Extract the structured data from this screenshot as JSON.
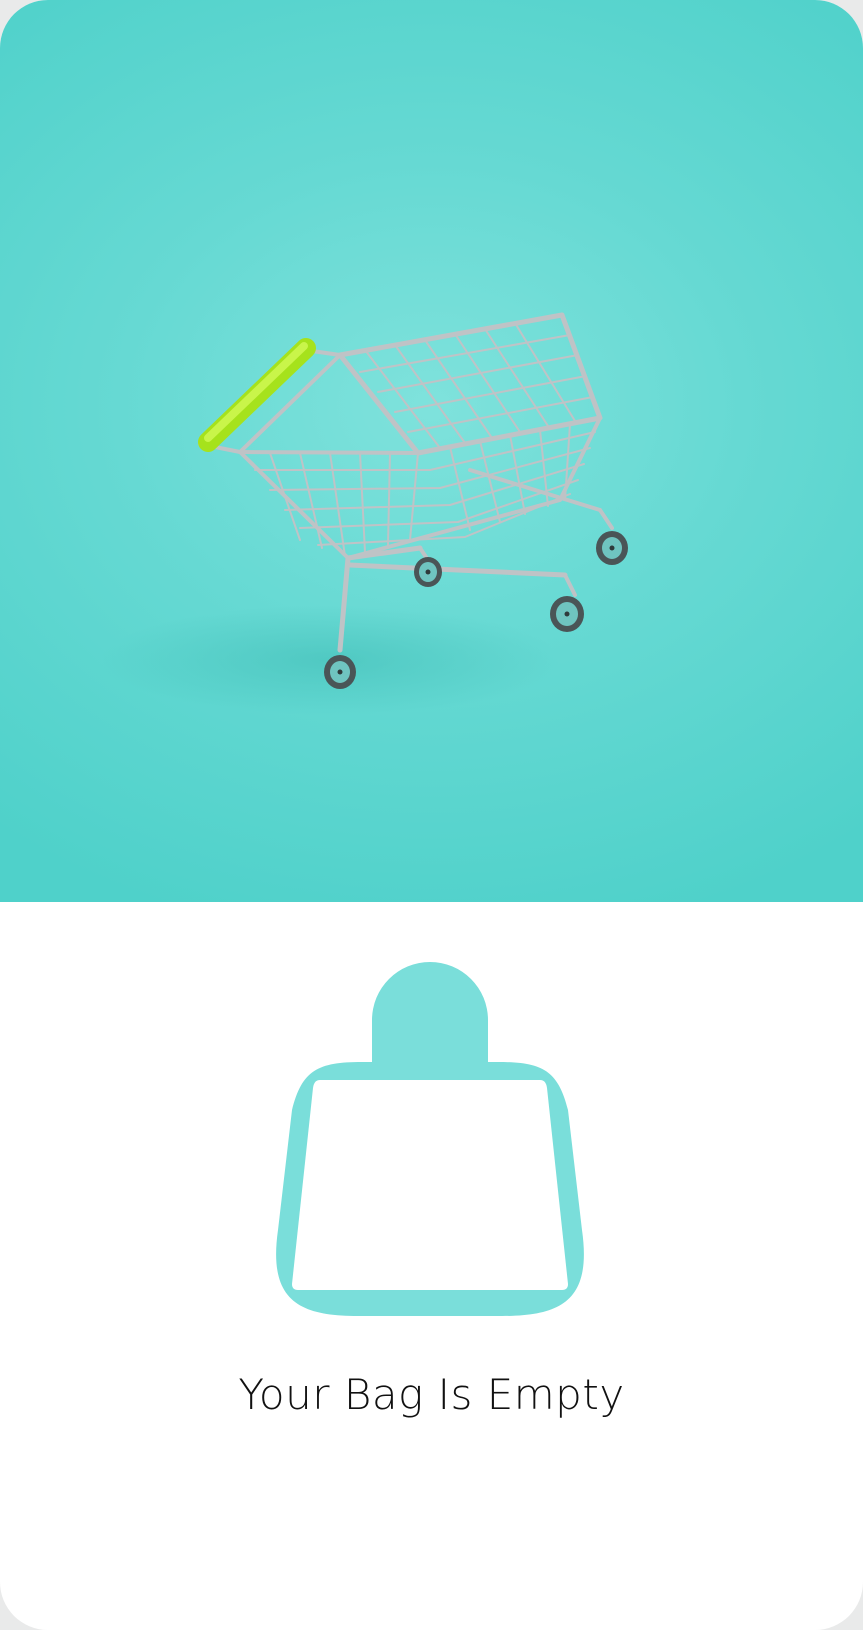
{
  "hero": {
    "image": "shopping-cart-illustration",
    "background_color": "#66d9d3",
    "handle_color": "#b8f02a",
    "wire_color": "#c0c4c6"
  },
  "empty_state": {
    "icon": "shopping-bag-icon",
    "icon_color": "#7adeda",
    "title": "Your Bag Is Empty"
  }
}
